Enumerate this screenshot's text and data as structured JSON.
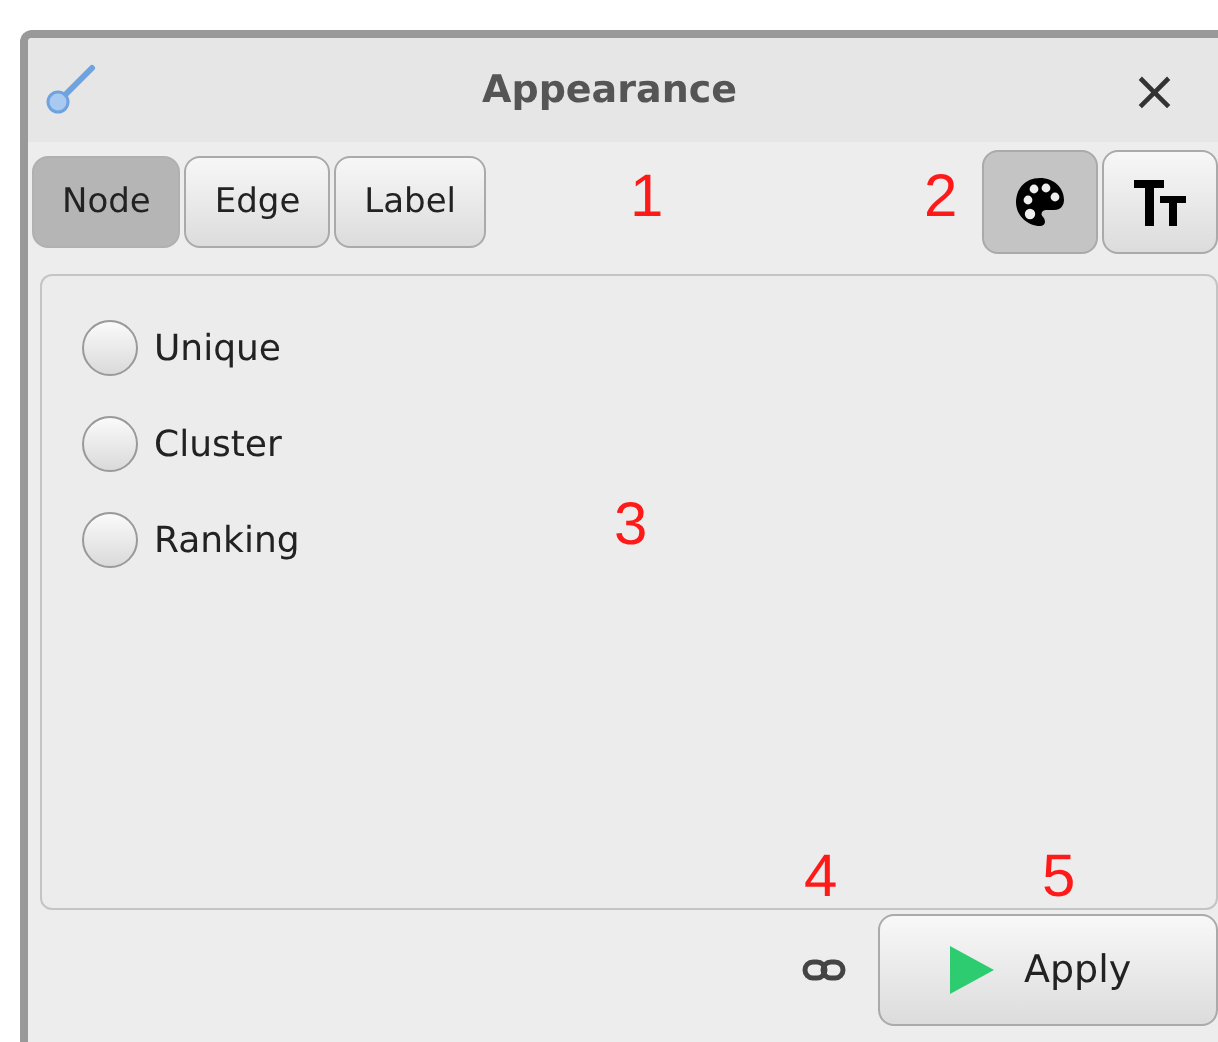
{
  "window": {
    "title": "Appearance",
    "close": "×"
  },
  "element_tabs": [
    {
      "label": "Node",
      "selected": true
    },
    {
      "label": "Edge",
      "selected": false
    },
    {
      "label": "Label",
      "selected": false
    }
  ],
  "mode_tabs": [
    {
      "kind": "color",
      "selected": true
    },
    {
      "kind": "size",
      "selected": false
    }
  ],
  "options": [
    {
      "label": "Unique",
      "selected": false
    },
    {
      "label": "Cluster",
      "selected": false
    },
    {
      "label": "Ranking",
      "selected": false
    }
  ],
  "apply_button": {
    "label": "Apply"
  },
  "callouts": [
    "1",
    "2",
    "3",
    "4",
    "5"
  ]
}
